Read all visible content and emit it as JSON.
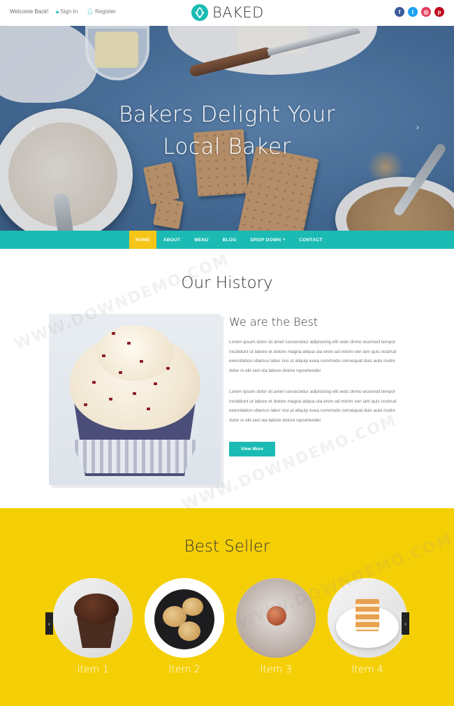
{
  "topbar": {
    "welcome": "Welcome Back!",
    "signin": "Sign In",
    "register": "Register"
  },
  "brand": {
    "name": "BAKED",
    "accent_color": "#1bbbb4"
  },
  "socials": [
    {
      "icon": "facebook-icon",
      "glyph": "f",
      "color": "#3b5998"
    },
    {
      "icon": "twitter-icon",
      "glyph": "t",
      "color": "#1da1f2"
    },
    {
      "icon": "instagram-icon",
      "glyph": "◎",
      "color": "#e4405f"
    },
    {
      "icon": "pinterest-icon",
      "glyph": "p",
      "color": "#bd081c"
    }
  ],
  "hero": {
    "line1": "Bakers Delight Your",
    "line2": "Local Baker",
    "prev_glyph": "‹",
    "next_glyph": "›"
  },
  "nav": {
    "items": [
      "HOME",
      "ABOUT",
      "MENU",
      "BLOG",
      "DROP DOWN",
      "CONTACT"
    ],
    "active": "HOME",
    "dropdown_caret": "▾",
    "active_color": "#f5c518"
  },
  "history": {
    "title": "Our History",
    "subtitle": "We are the Best",
    "para1": "Lorem ipsum dolor sit amet consectetur adipisicing elit sedc dnmo eiusmod tempor incididunt ut labore et dolore magna aliqua uta enim ad minim ven iam quis nostrud exercitation ullamco labor nisi ut aliquip exea commodo consequat duis aute irudre dolor in elit sed uta labore dolore reprehender",
    "para2": "Lorem ipsum dolor sit amet consectetur adipisicing elit sedc dnmo eiusmod tempor incididunt ut labore et dolore magna aliqua uta enim ad minim ven iam quis nostrud exercitation ullamco labor nisi ut aliquip exea commodo consequat duis aute irudre dolor in elit sed uta labore dolore reprehender",
    "button": "View More"
  },
  "bestseller": {
    "title": "Best Seller",
    "background_color": "#f5cf06",
    "items": [
      {
        "label": "Item 1"
      },
      {
        "label": "Item 2"
      },
      {
        "label": "Item 3"
      },
      {
        "label": "Item 4"
      }
    ],
    "prev_glyph": "‹",
    "next_glyph": "›"
  },
  "watermark": "WWW.DOWNDEMO.COM"
}
